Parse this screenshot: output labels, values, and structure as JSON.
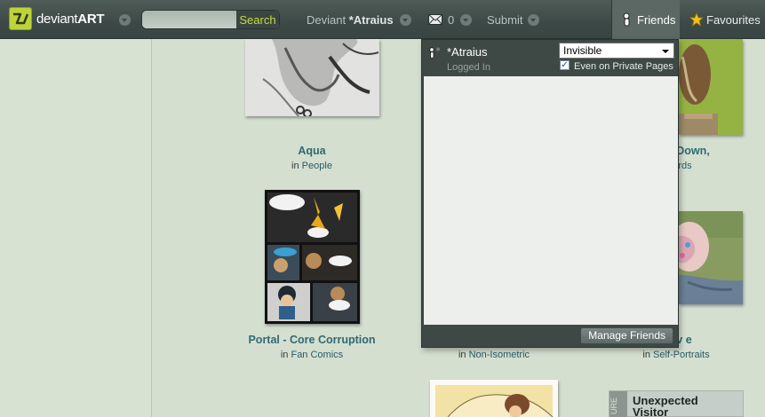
{
  "colors": {
    "accent": "#c7dc3c",
    "topbar": "#3d4946",
    "page_bg": "#d4dfd0",
    "link": "#2f6a73"
  },
  "header": {
    "logo": {
      "wordmark_light": "deviant",
      "wordmark_bold": "ART"
    },
    "search": {
      "placeholder": "",
      "button_label": "Search"
    },
    "user": {
      "prefix": "Deviant",
      "name": "*Atraius"
    },
    "messages": {
      "count": "0",
      "icon": "envelope-icon"
    },
    "submit_label": "Submit",
    "friends_label": "Friends",
    "favourites_label": "Favourites"
  },
  "friends_panel": {
    "username": "*Atraius",
    "status_text": "Logged In",
    "visibility_options": [
      "Invisible"
    ],
    "visibility_selected": "Invisible",
    "private_pages_label": "Even on Private Pages",
    "private_pages_checked": true,
    "manage_button": "Manage Friends"
  },
  "gallery": [
    {
      "title": "Aqua",
      "in": "in",
      "category": "People"
    },
    {
      "title": "Down,",
      "in": "",
      "category": "rds"
    },
    {
      "title": "Portal - Core Corruption",
      "in": "in",
      "category": "Fan Comics"
    },
    {
      "title": "",
      "in": "in",
      "category": "Non-Isometric"
    },
    {
      "title": "v e",
      "in": "in",
      "category": "Self-Portraits"
    }
  ],
  "feature_card": {
    "side_label": "URE",
    "title_line1": "Unexpected",
    "title_line2": "Visitor"
  }
}
